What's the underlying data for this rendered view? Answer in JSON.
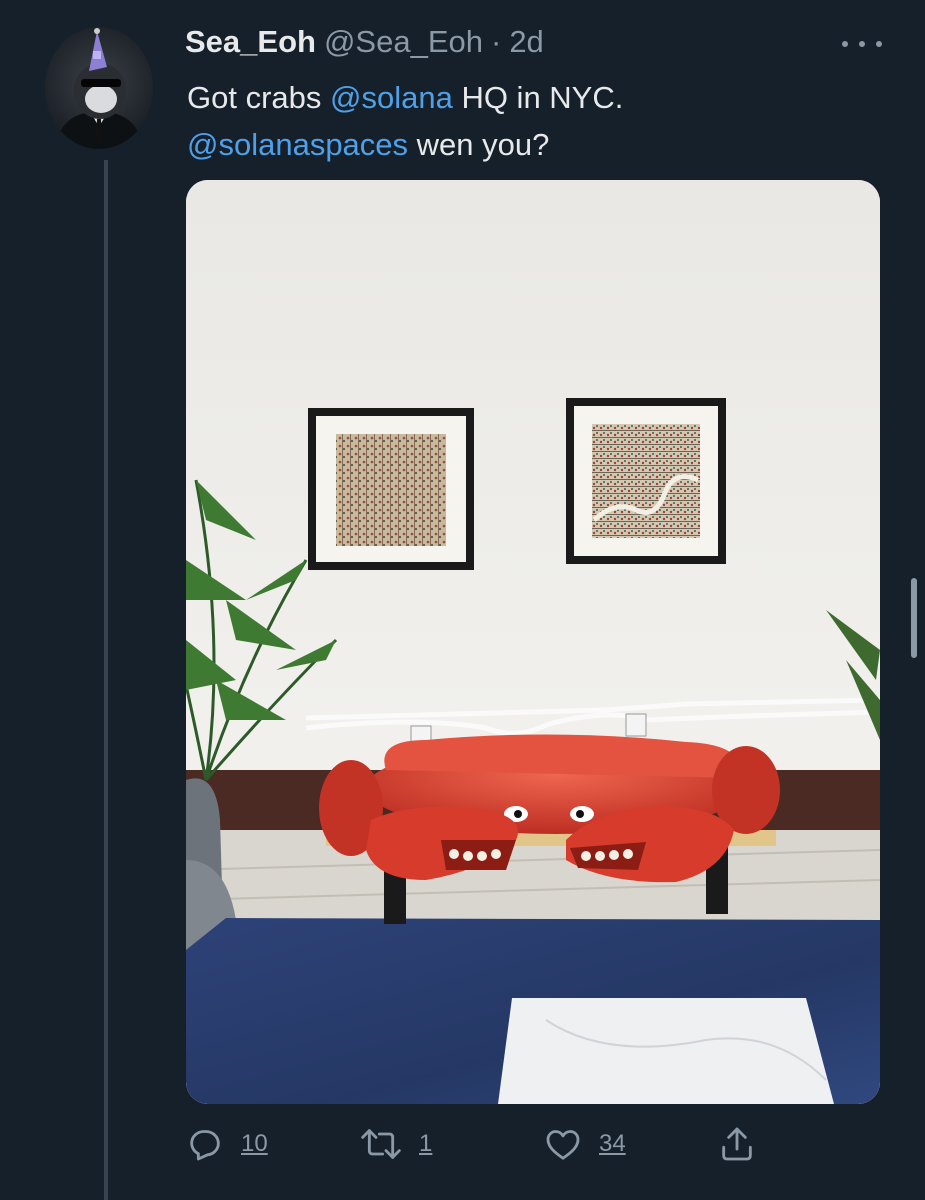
{
  "tweet": {
    "display_name": "Sea_Eoh",
    "handle": "@Sea_Eoh",
    "separator": "·",
    "time": "2d",
    "text_parts": {
      "p1": "Got crabs ",
      "mention1": "@solana",
      "p2": " HQ in NYC.",
      "mention2": "@solanaspaces",
      "p3": " wen you?"
    }
  },
  "actions": {
    "reply_count": "10",
    "retweet_count": "1",
    "like_count": "34"
  },
  "icons": {
    "more": "more-horizontal-icon",
    "reply": "reply-icon",
    "retweet": "retweet-icon",
    "like": "heart-icon",
    "share": "share-icon"
  },
  "colors": {
    "background": "#15202b",
    "text": "#e7e9ea",
    "muted": "#8b98a5",
    "link": "#4fa0e8"
  }
}
